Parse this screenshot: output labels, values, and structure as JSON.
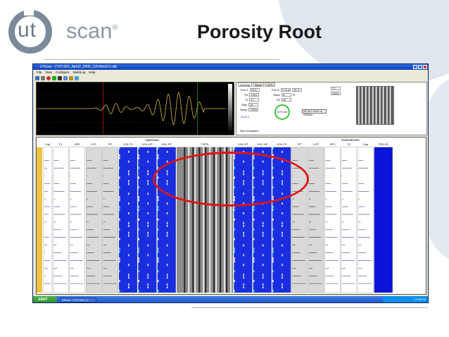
{
  "slide": {
    "title": "Porosity Root",
    "logo": {
      "left": "ut",
      "right": "scan",
      "mark": "®"
    }
  },
  "app": {
    "window_title": "UTscan - [TST-001_Apr02_2005_12h20m37s.utl]",
    "menu": [
      "File",
      "View",
      "Configure",
      "WeldLog",
      "Help"
    ],
    "toolbar_icons": [
      "save-icon",
      "print-icon",
      "record-icon",
      "play-icon",
      "stop-icon",
      "zoom-icon",
      "settings-icon",
      "help-icon"
    ],
    "tabs": [
      "General",
      "Bevel",
      "GPS"
    ],
    "params_left": [
      {
        "label": "Pos X",
        "value": "1074"
      },
      {
        "label": "TD",
        "value": "1.521"
      },
      {
        "label": "Tx",
        "value": "17"
      },
      {
        "label": "Step",
        "value": "16"
      },
      {
        "label": "Setup",
        "value": "TOFD"
      }
    ],
    "params_right": [
      {
        "label": "Pos G",
        "value": "0.70 m",
        "extra": "20 %"
      },
      {
        "label": "Head",
        "value": "47",
        "extra": "%"
      },
      {
        "label": "Rx",
        "value": "16"
      }
    ],
    "zone_label": "Zone 2",
    "gauge_value": "1074 mm",
    "hint_text": "Hlt Hw:0.00mm at 2490mm",
    "selects": [
      "TT",
      "100%"
    ],
    "status": "Not Unmasked",
    "taskbar_item": "UTscan - [TST-001_A...",
    "clock": "12:38 PM",
    "start": "start"
  },
  "tracks": {
    "upstream_label": "Upstream",
    "downstream_label": "Downstream",
    "headers": [
      "Cap",
      "F1",
      "HP1",
      "LCP",
      "RT",
      "VOL-F1",
      "VOL-HP",
      "VOL-RT",
      "TOFD",
      "VOL-RT",
      "VOL-HP",
      "VOL-F1",
      "RT",
      "LCP",
      "HP1",
      "F1",
      "Cap",
      "TRU-ID"
    ]
  },
  "colors": {
    "title": "#1a1a1a",
    "highlight": "#e11414",
    "vol_blue": "#1a2ee0",
    "truid_blue": "#0a14d8",
    "wave": "#d8b840"
  }
}
